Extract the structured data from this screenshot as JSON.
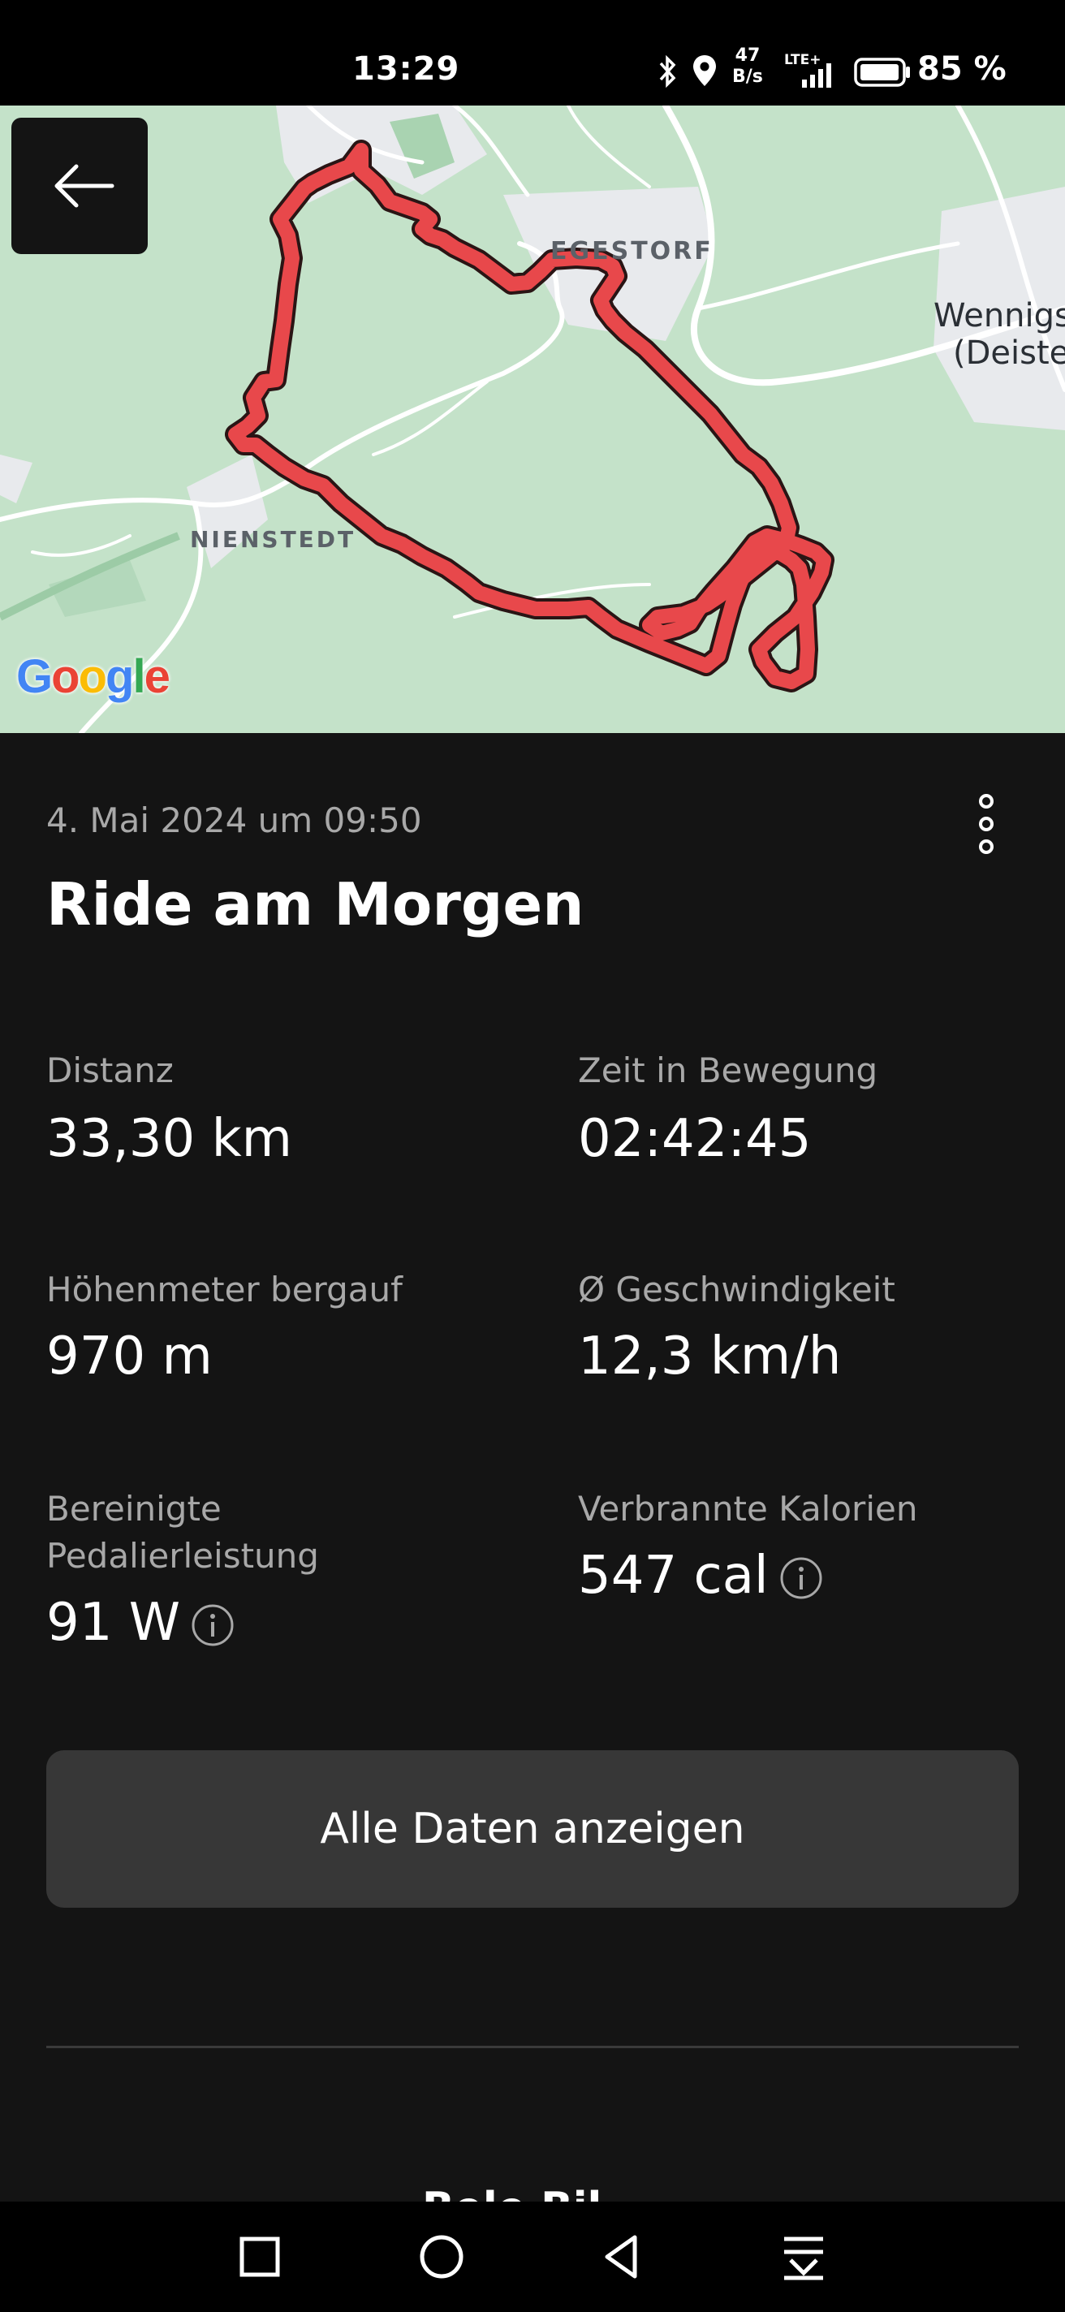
{
  "status_bar": {
    "time": "13:29",
    "net_speed_value": "47",
    "net_speed_unit": "B/s",
    "network": "LTE+",
    "battery": "85 %",
    "icons": [
      "bluetooth-icon",
      "location-icon",
      "signal-icon",
      "battery-icon"
    ]
  },
  "map": {
    "labels": {
      "egestorf": "EGESTORF",
      "nienstedt": "NIENSTEDT",
      "wennigsen_line1": "Wennigs",
      "wennigsen_line2": "(Deiste"
    },
    "attribution": "Google",
    "route_color": "#e8484b"
  },
  "activity": {
    "date": "4. Mai 2024 um 09:50",
    "title": "Ride am Morgen"
  },
  "stats": {
    "distance": {
      "label": "Distanz",
      "value": "33,30 km"
    },
    "moving_time": {
      "label": "Zeit in Bewegung",
      "value": "02:42:45"
    },
    "elevation": {
      "label": "Höhenmeter bergauf",
      "value": "970 m"
    },
    "avg_speed": {
      "label": "Ø Geschwindigkeit",
      "value": "12,3 km/h"
    },
    "power": {
      "label_line1": "Bereinigte",
      "label_line2": "Pedalierleistung",
      "value": "91 W"
    },
    "calories": {
      "label": "Verbrannte Kalorien",
      "value": "547 cal"
    }
  },
  "buttons": {
    "all_data": "Alle Daten anzeigen"
  },
  "peek": "Bele Bil"
}
